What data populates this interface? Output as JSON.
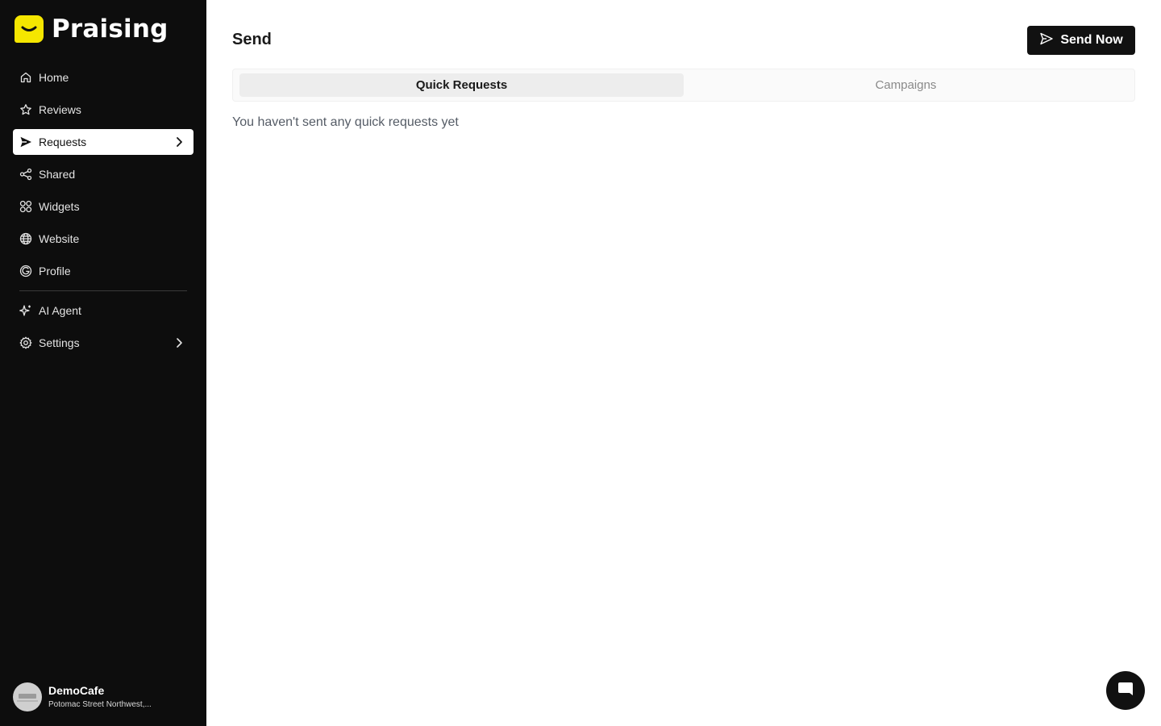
{
  "brand": {
    "name": "Praising",
    "logo_color": "#f5e600"
  },
  "sidebar": {
    "items": [
      {
        "label": "Home",
        "icon": "home-icon"
      },
      {
        "label": "Reviews",
        "icon": "star-icon"
      },
      {
        "label": "Requests",
        "icon": "send-icon",
        "active": true
      },
      {
        "label": "Shared",
        "icon": "share-icon"
      },
      {
        "label": "Widgets",
        "icon": "widgets-icon"
      },
      {
        "label": "Website",
        "icon": "globe-icon"
      },
      {
        "label": "Profile",
        "icon": "google-icon"
      }
    ],
    "secondary": [
      {
        "label": "AI Agent",
        "icon": "sparkle-icon"
      },
      {
        "label": "Settings",
        "icon": "gear-icon",
        "has_submenu": true
      }
    ],
    "account": {
      "name": "DemoCafe",
      "address": "Potomac Street Northwest,..."
    }
  },
  "main": {
    "title": "Send",
    "send_button": "Send Now",
    "tabs": [
      {
        "label": "Quick Requests",
        "active": true
      },
      {
        "label": "Campaigns",
        "active": false
      }
    ],
    "empty_message": "You haven't sent any quick requests yet"
  },
  "colors": {
    "sidebar_bg": "#0d0d0d",
    "primary": "#111111",
    "accent": "#f5e600"
  }
}
